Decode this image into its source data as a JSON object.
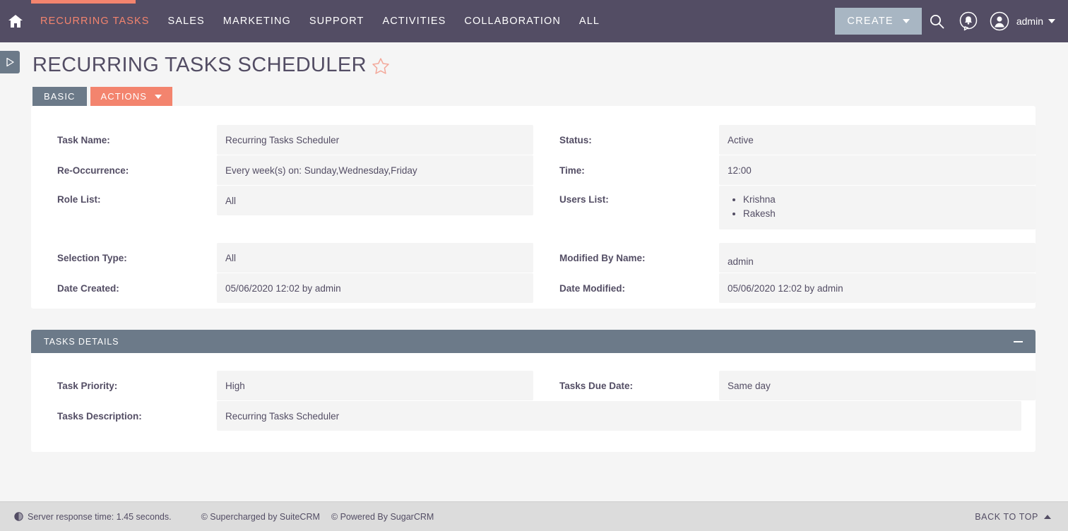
{
  "nav": {
    "home_icon": "home-icon",
    "items": [
      {
        "label": "Recurring Tasks",
        "active": true
      },
      {
        "label": "Sales",
        "active": false
      },
      {
        "label": "Marketing",
        "active": false
      },
      {
        "label": "Support",
        "active": false
      },
      {
        "label": "Activities",
        "active": false
      },
      {
        "label": "Collaboration",
        "active": false
      },
      {
        "label": "All",
        "active": false
      }
    ],
    "create_label": "CREATE",
    "search_icon": "search-icon",
    "notifications_icon": "notification-bell-icon",
    "avatar_icon": "user-avatar-icon",
    "admin_label": "admin",
    "accent_color": "#f3846e",
    "bar_color": "#534d64",
    "create_btn_color": "#a8b6c3"
  },
  "sidebar_toggle": {
    "icon": "expand-sidebar-triangle-icon"
  },
  "header": {
    "title": "Recurring Tasks Scheduler",
    "favorite_icon": "star-outline-icon"
  },
  "tabs": {
    "basic_label": "BASIC",
    "actions_label": "ACTIONS"
  },
  "basic_panel": {
    "rows": [
      {
        "label": "Task Name:",
        "value": "Recurring Tasks Scheduler"
      },
      {
        "label": "Status:",
        "value": "Active"
      },
      {
        "label": "Re-Occurrence:",
        "value": "Every week(s) on: Sunday,Wednesday,Friday"
      },
      {
        "label": "Time:",
        "value": "12:00"
      },
      {
        "label": "Role List:",
        "value": "All"
      },
      {
        "label": "Users List:",
        "values": [
          "Krishna",
          "Rakesh"
        ]
      },
      {
        "label": "Selection Type:",
        "value": "All"
      },
      {
        "label": "Modified By Name:",
        "value": "admin"
      },
      {
        "label": "Date Created:",
        "value": "05/06/2020 12:02 by admin"
      },
      {
        "label": "Date Modified:",
        "value": "05/06/2020 12:02 by admin"
      }
    ]
  },
  "details_panel": {
    "title": "TASKS DETAILS",
    "collapse_icon": "minus-icon",
    "rows": [
      {
        "label": "Task Priority:",
        "value": "High"
      },
      {
        "label": "Tasks Due Date:",
        "value": "Same day"
      },
      {
        "label": "Tasks Description:",
        "value": "Recurring Tasks Scheduler"
      }
    ]
  },
  "footer": {
    "clock_icon": "clock-icon",
    "response_time": "Server response time: 1.45 seconds.",
    "supercharged": "© Supercharged by SuiteCRM",
    "powered": "© Powered By SugarCRM",
    "back_to_top": "BACK TO TOP"
  }
}
